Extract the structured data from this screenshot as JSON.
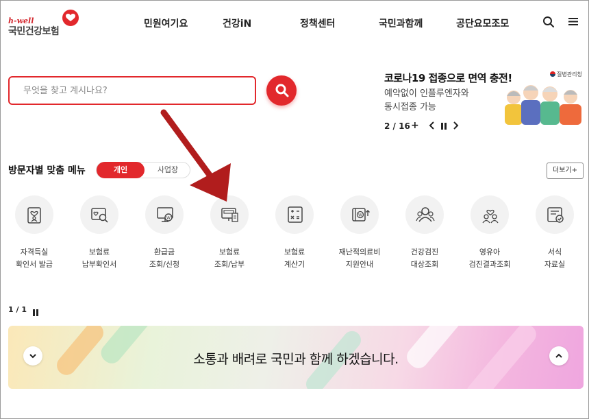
{
  "logo": {
    "top": "h-well",
    "main": "국민건강보험"
  },
  "nav": {
    "items": [
      "민원여기요",
      "건강iN",
      "정책센터",
      "국민과함께",
      "공단요모조모"
    ]
  },
  "icons": {
    "search": "search-icon",
    "menu": "hamburger-icon"
  },
  "search": {
    "placeholder": "무엇을 찾고 계시나요?",
    "value": ""
  },
  "promo": {
    "title": "코로나19 접종으로 면역 충전!",
    "subtitle_line1": "예약없이 인플루엔자와",
    "subtitle_line2": "동시접종 가능",
    "agency": "질병관리청",
    "counter": "2 / 16",
    "plus": "+"
  },
  "menu": {
    "title": "방문자별 맞춤 메뉴",
    "tab_personal": "개인",
    "tab_business": "사업장",
    "more": "더보기+",
    "items": [
      {
        "line1": "자격득실",
        "line2": "확인서 발급",
        "icon": "id-card-heart-icon"
      },
      {
        "line1": "보험료",
        "line2": "납부확인서",
        "icon": "document-search-icon"
      },
      {
        "line1": "환급금",
        "line2": "조회/신청",
        "icon": "monitor-won-icon"
      },
      {
        "line1": "보험료",
        "line2": "조회/납부",
        "icon": "receipt-monitor-icon"
      },
      {
        "line1": "보험료",
        "line2": "계산기",
        "icon": "calculator-icon"
      },
      {
        "line1": "재난적의료비",
        "line2": "지원안내",
        "icon": "wallet-won-icon"
      },
      {
        "line1": "건강검진",
        "line2": "대상조회",
        "icon": "people-search-icon"
      },
      {
        "line1": "영유아",
        "line2": "검진결과조회",
        "icon": "family-heart-icon"
      },
      {
        "line1": "서식",
        "line2": "자료실",
        "icon": "form-check-icon"
      }
    ]
  },
  "pager": {
    "text": "1 / 1"
  },
  "banner": {
    "text": "소통과 배려로 국민과 함께 하겠습니다."
  },
  "colors": {
    "accent": "#e2282c",
    "text": "#222222",
    "muted": "#f2f2f2"
  }
}
